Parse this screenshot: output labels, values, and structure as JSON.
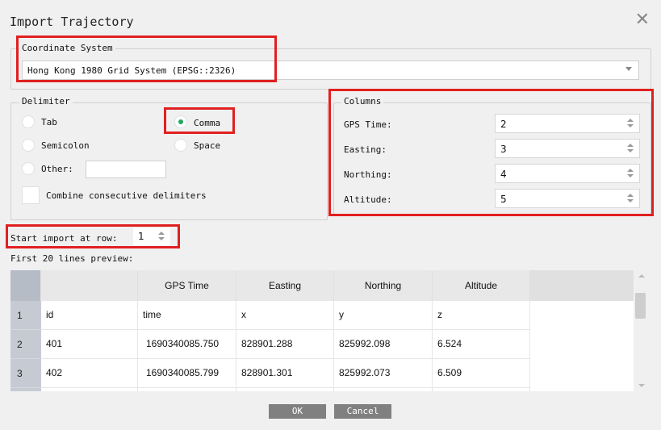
{
  "dialog": {
    "title": "Import Trajectory"
  },
  "coordinate_system": {
    "legend": "Coordinate System",
    "selected": "Hong Kong 1980 Grid System (EPSG::2326)"
  },
  "delimiter": {
    "legend": "Delimiter",
    "options": {
      "tab": "Tab",
      "comma": "Comma",
      "semicolon": "Semicolon",
      "space": "Space",
      "other": "Other:"
    },
    "selected": "comma",
    "other_value": "",
    "combine_label": "Combine consecutive delimiters"
  },
  "columns": {
    "legend": "Columns",
    "fields": [
      {
        "label": "GPS Time:",
        "value": "2"
      },
      {
        "label": "Easting:",
        "value": "3"
      },
      {
        "label": "Northing:",
        "value": "4"
      },
      {
        "label": "Altitude:",
        "value": "5"
      }
    ]
  },
  "start_row": {
    "label": "Start import at row:",
    "value": "1"
  },
  "preview": {
    "label": "First 20 lines preview:",
    "headers": [
      "GPS Time",
      "Easting",
      "Northing",
      "Altitude"
    ],
    "rows": [
      {
        "num": "1",
        "cells": [
          "id",
          "time",
          "x",
          "y",
          "z"
        ]
      },
      {
        "num": "2",
        "cells": [
          "401",
          "1690340085.750",
          "828901.288",
          "825992.098",
          "6.524"
        ]
      },
      {
        "num": "3",
        "cells": [
          "402",
          "1690340085.799",
          "828901.301",
          "825992.073",
          "6.509"
        ]
      },
      {
        "num": "",
        "cells": [
          "",
          "",
          "",
          "",
          ""
        ]
      }
    ]
  },
  "buttons": {
    "ok": "OK",
    "cancel": "Cancel"
  },
  "colors": {
    "highlight": "#e02020",
    "radio_on": "#1faa5e",
    "button": "#808080"
  }
}
